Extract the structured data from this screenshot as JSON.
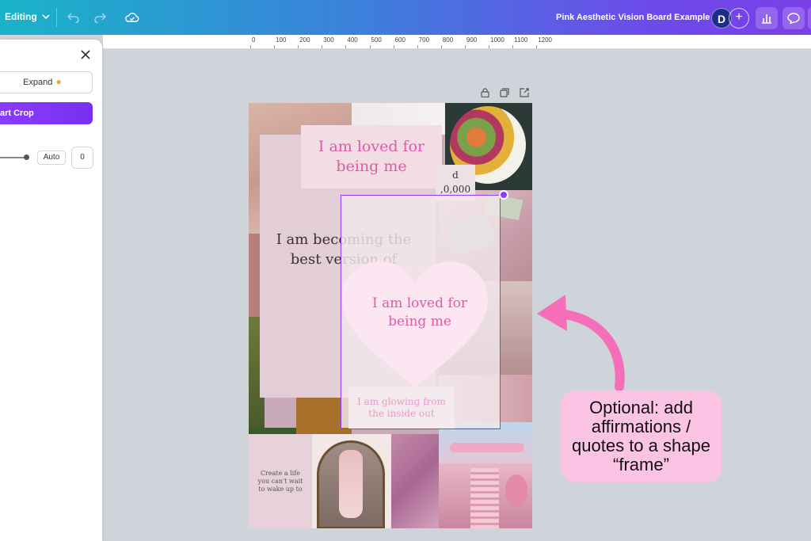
{
  "topbar": {
    "mode_label": "Editing",
    "title": "Pink Aesthetic Vision Board Example",
    "avatar_letter": "D"
  },
  "ruler": {
    "ticks": [
      "0",
      "100",
      "200",
      "300",
      "400",
      "500",
      "600",
      "700",
      "800",
      "900",
      "1000",
      "1100",
      "1200"
    ]
  },
  "panel": {
    "expand_label": "Expand",
    "crop_label": "art Crop",
    "auto_label": "Auto",
    "value": "0"
  },
  "canvas": {
    "quote_top": "I am loved for being me",
    "quote_becoming": "I am becoming the best version of",
    "money_fragment_1": "d",
    "money_fragment_2": ",0,000",
    "heart_quote": "I am loved for being me",
    "glowing_quote": "I am glowing from the inside out",
    "create_life": "Create a life you can't wait to wake up to"
  },
  "annotation": {
    "text": "Optional: add affirmations / quotes to a shape “frame”"
  },
  "colors": {
    "accent": "#8b3dff",
    "callout_bg": "#fbc4e4",
    "arrow": "#f46fb8",
    "quote_pink": "#e05aa8"
  }
}
